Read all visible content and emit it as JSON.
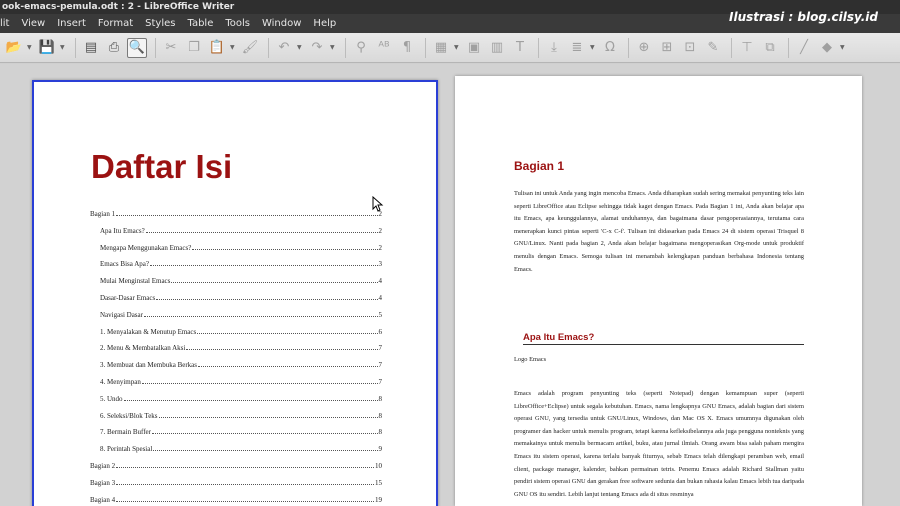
{
  "window": {
    "title": "ook-emacs-pemula.odt : 2 - LibreOffice Writer"
  },
  "watermark": "Ilustrasi : blog.cilsy.id",
  "menu": [
    "lit",
    "View",
    "Insert",
    "Format",
    "Styles",
    "Table",
    "Tools",
    "Window",
    "Help"
  ],
  "toc": {
    "title": "Daftar Isi",
    "entries": [
      {
        "label": "Bagian 1",
        "page": "2",
        "level": 1
      },
      {
        "label": "Apa Itu Emacs?",
        "page": "2",
        "level": 2
      },
      {
        "label": "Mengapa Menggunakan Emacs?",
        "page": "2",
        "level": 2
      },
      {
        "label": "Emacs Bisa Apa?",
        "page": "3",
        "level": 2
      },
      {
        "label": "Mulai Menginstal Emacs",
        "page": "4",
        "level": 2
      },
      {
        "label": "Dasar-Dasar Emacs",
        "page": "4",
        "level": 2
      },
      {
        "label": "Navigasi Dasar",
        "page": "5",
        "level": 2
      },
      {
        "label": "1. Menyalakan & Menutup Emacs",
        "page": "6",
        "level": 2
      },
      {
        "label": "2. Menu & Membatalkan Aksi",
        "page": "7",
        "level": 2
      },
      {
        "label": "3. Membuat dan Membuka Berkas",
        "page": "7",
        "level": 2
      },
      {
        "label": "4. Menyimpan",
        "page": "7",
        "level": 2
      },
      {
        "label": "5. Undo",
        "page": "8",
        "level": 2
      },
      {
        "label": "6. Seleksi/Blok Teks",
        "page": "8",
        "level": 2
      },
      {
        "label": "7. Bermain Buffer",
        "page": "8",
        "level": 2
      },
      {
        "label": "8. Perintah Spesial",
        "page": "9",
        "level": 2
      },
      {
        "label": "Bagian 2",
        "page": "10",
        "level": 1
      },
      {
        "label": "Bagian 3",
        "page": "15",
        "level": 1
      },
      {
        "label": "Bagian 4",
        "page": "19",
        "level": 1
      }
    ]
  },
  "right_page": {
    "heading": "Bagian 1",
    "intro": "Tulisan ini untuk Anda yang ingin mencoba Emacs. Anda diharapkan sudah sering memakai penyunting teks lain seperti LibreOffice atau Eclipse sehingga tidak kaget dengan Emacs. Pada Bagian 1 ini, Anda akan belajar apa itu Emacs, apa keunggulannya, alamat unduhannya, dan bagaimana dasar pengoperasiannya, terutama cara menerapkan kunci pintas seperti 'C-x C-f'. Tulisan ini didasarkan pada Emacs 24 di sistem operasi Trisquel 8 GNU/Linux. Nanti pada bagian 2, Anda akan belajar bagaimana mengoperasikan Org-mode untuk produktif menulis dengan Emacs. Semoga tulisan ini menambah kelengkapan panduan berbahasa Indonesia tentang Emacs.",
    "subheading": "Apa Itu Emacs?",
    "caption": "Logo Emacs",
    "body": "Emacs adalah program penyunting teks (seperti Notepad) dengan kemampuan super (seperti LibreOffice+Eclipse) untuk segala kebutuhan. Emacs, nama lengkapnya GNU Emacs, adalah bagian dari sistem operasi GNU, yang tersedia untuk GNU/Linux, Windows, dan Mac OS X. Emacs umumnya digunakan oleh programer dan hacker untuk menulis program, tetapi karena kefleksibelannya ada juga pengguna nonteknis yang memakainya untuk menulis bermacam artikel, buku, atau jurnal ilmiah. Orang awam bisa salah paham mengira Emacs itu sistem operasi, karena terlalu banyak fiturnya, sebab Emacs telah dilengkapi peramban web, email client, package manager, kalender, bahkan permainan tetris. Penemu Emacs adalah Richard Stallman yaitu pendiri sistem operasi GNU dan gerakan free software sedunia dan bukan rahasia kalau Emacs lebih tua daripada GNU OS itu sendiri. Lebih lanjut tentang Emacs ada di situs resminya"
  },
  "toolbar": [
    {
      "name": "open-icon",
      "glyph": "📂",
      "arrow": true
    },
    {
      "name": "save-icon",
      "glyph": "💾",
      "arrow": true
    },
    {
      "sep": true
    },
    {
      "name": "export-pdf-icon",
      "glyph": "▤"
    },
    {
      "name": "print-icon",
      "glyph": "⎙"
    },
    {
      "name": "print-preview-icon",
      "glyph": "🔍",
      "active": true
    },
    {
      "sep": true
    },
    {
      "name": "cut-icon",
      "glyph": "✂",
      "dim": true
    },
    {
      "name": "copy-icon",
      "glyph": "❐",
      "dim": true
    },
    {
      "name": "paste-icon",
      "glyph": "📋",
      "dim": true,
      "arrow": true
    },
    {
      "name": "clone-formatting-icon",
      "glyph": "🖌",
      "dim": true
    },
    {
      "sep": true
    },
    {
      "name": "undo-icon",
      "glyph": "↶",
      "dim": true,
      "arrow": true
    },
    {
      "name": "redo-icon",
      "glyph": "↷",
      "dim": true,
      "arrow": true
    },
    {
      "sep": true
    },
    {
      "name": "find-replace-icon",
      "glyph": "⚲",
      "dim": true
    },
    {
      "name": "spelling-icon",
      "glyph": "ᴬᴮ",
      "dim": true
    },
    {
      "name": "formatting-marks-icon",
      "glyph": "¶",
      "dim": true
    },
    {
      "sep": true
    },
    {
      "name": "insert-table-icon",
      "glyph": "▦",
      "dim": true,
      "arrow": true
    },
    {
      "name": "insert-image-icon",
      "glyph": "▣",
      "dim": true
    },
    {
      "name": "insert-chart-icon",
      "glyph": "▥",
      "dim": true
    },
    {
      "name": "insert-textbox-icon",
      "glyph": "T",
      "dim": true
    },
    {
      "sep": true
    },
    {
      "name": "page-break-icon",
      "glyph": "⤓",
      "dim": true
    },
    {
      "name": "insert-field-icon",
      "glyph": "≣",
      "dim": true,
      "arrow": true
    },
    {
      "name": "special-character-icon",
      "glyph": "Ω",
      "dim": true
    },
    {
      "sep": true
    },
    {
      "name": "hyperlink-icon",
      "glyph": "⊕",
      "dim": true
    },
    {
      "name": "footnote-icon",
      "glyph": "⊞",
      "dim": true
    },
    {
      "name": "comment-icon",
      "glyph": "⊡",
      "dim": true
    },
    {
      "name": "track-changes-icon",
      "glyph": "✎",
      "dim": true
    },
    {
      "sep": true
    },
    {
      "name": "insert-line-icon",
      "glyph": "⊤",
      "dim": true
    },
    {
      "name": "insert-frame-icon",
      "glyph": "⧉",
      "dim": true
    },
    {
      "sep": true
    },
    {
      "name": "line-tool-icon",
      "glyph": "╱",
      "dim": true
    },
    {
      "name": "basic-shapes-icon",
      "glyph": "◆",
      "dim": true,
      "arrow": true
    }
  ]
}
